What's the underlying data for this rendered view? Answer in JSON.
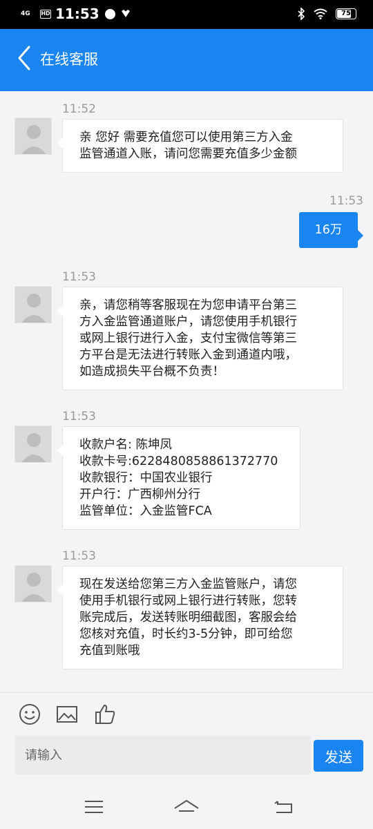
{
  "status_bar": {
    "network": "4G",
    "hd_label": "HD",
    "time": "11:53",
    "battery": "75",
    "battery_level": 0.75
  },
  "header": {
    "title": "在线客服"
  },
  "messages": [
    {
      "time": "11:52",
      "side": "left",
      "lines": [
        "亲 您好 需要充值您可以使用第三方入金",
        "监管通道入账，请问您需要充值多少金额"
      ]
    },
    {
      "time": "11:53",
      "side": "right",
      "lines": [
        "16万"
      ]
    },
    {
      "time": "11:53",
      "side": "left",
      "lines": [
        "亲，请您稍等客服现在为您申请平台第三",
        "方入金监管通道账户，请您使用手机银行",
        "或网上银行进行入金，支付宝微信等第三",
        "方平台是无法进行转账入金到通道内哦，",
        "如造成损失平台概不负责！"
      ]
    },
    {
      "time": "11:53",
      "side": "left",
      "lines": [
        "收款户名: 陈坤凤",
        "收款卡号:6228480858861372770",
        "收款银行：中国农业银行",
        "开户行：广西柳州分行",
        "监管单位：入金监管FCA"
      ]
    },
    {
      "time": "11:53",
      "side": "left",
      "lines": [
        "现在发送给您第三方入金监管账户，请您",
        "使用手机银行或网上银行进行转账，您转",
        "账完成后，发送转账明细截图，客服会给",
        "您核对充值，时长约3-5分钟，即可给您",
        "充值到账哦"
      ]
    }
  ],
  "input": {
    "placeholder": "请输入",
    "value": ""
  },
  "send_button": {
    "label": "发送"
  },
  "toolbar": {
    "icons": [
      "emoji-icon",
      "image-icon",
      "thumbs-up-icon"
    ]
  },
  "colors": {
    "accent": "#1a84f0",
    "background": "#f4f4f6",
    "bubble": "#ffffff",
    "timestamp": "#999999"
  }
}
